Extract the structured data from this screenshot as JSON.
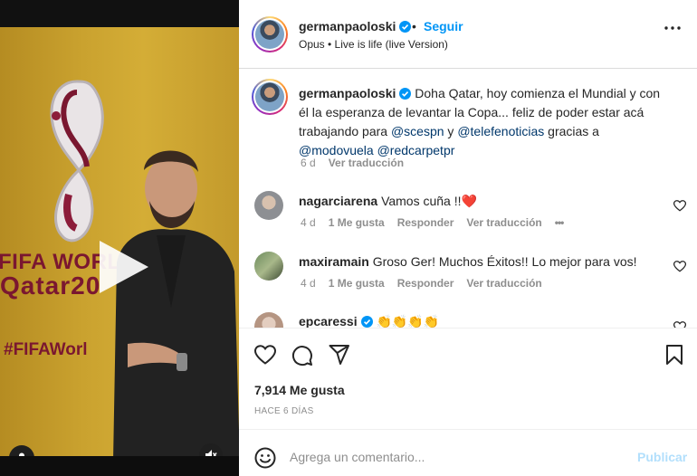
{
  "colors": {
    "accent": "#0095f6",
    "mention": "#00376b",
    "muted": "#8e8e8e",
    "heart": "#ed4956",
    "publish_disabled": "#b2dffc",
    "banner_maroon": "#7a1730",
    "banner_gold": "#c9a130"
  },
  "video": {
    "banner_line1": "FIFA WORLD",
    "banner_line2": "Qatar20",
    "banner_hashtag": "#FIFAWorl",
    "icons": [
      "play-icon",
      "user-icon",
      "mute-icon"
    ]
  },
  "header": {
    "username": "germanpaoloski",
    "separator": "•",
    "follow_label": "Seguir",
    "audio": "Opus • Live is life (live Version)"
  },
  "caption": {
    "username": "germanpaoloski",
    "text_part1": "Doha Qatar, hoy comienza el Mundial y con él la esperanza de levantar la Copa... feliz de poder estar acá trabajando para ",
    "mention1": "@scespn",
    "text_part2": " y ",
    "mention2": "@telefenoticias",
    "text_part3": " gracias a ",
    "mention3": "@modovuela",
    "text_part4": " ",
    "mention4": "@redcarpetpr",
    "time": "6 d",
    "translate": "Ver traducción"
  },
  "comments": [
    {
      "username": "nagarciarena",
      "text": "Vamos cuña !!",
      "emoji": "❤️",
      "time": "4 d",
      "likes": "1 Me gusta",
      "reply": "Responder",
      "translate": "Ver traducción",
      "more": "•••"
    },
    {
      "username": "maxiramain",
      "text": "Groso Ger! Muchos Éxitos!! Lo mejor para vos!",
      "time": "4 d",
      "likes": "1 Me gusta",
      "reply": "Responder",
      "translate": "Ver traducción"
    },
    {
      "username": "epcaressi",
      "text": "👏👏👏👏"
    }
  ],
  "actions": {
    "icons": [
      "heart-icon",
      "comment-icon",
      "share-icon",
      "bookmark-icon"
    ]
  },
  "likes": "7,914 Me gusta",
  "time_ago": "HACE 6 DÍAS",
  "comment_box": {
    "placeholder": "Agrega un comentario...",
    "publish_label": "Publicar"
  }
}
